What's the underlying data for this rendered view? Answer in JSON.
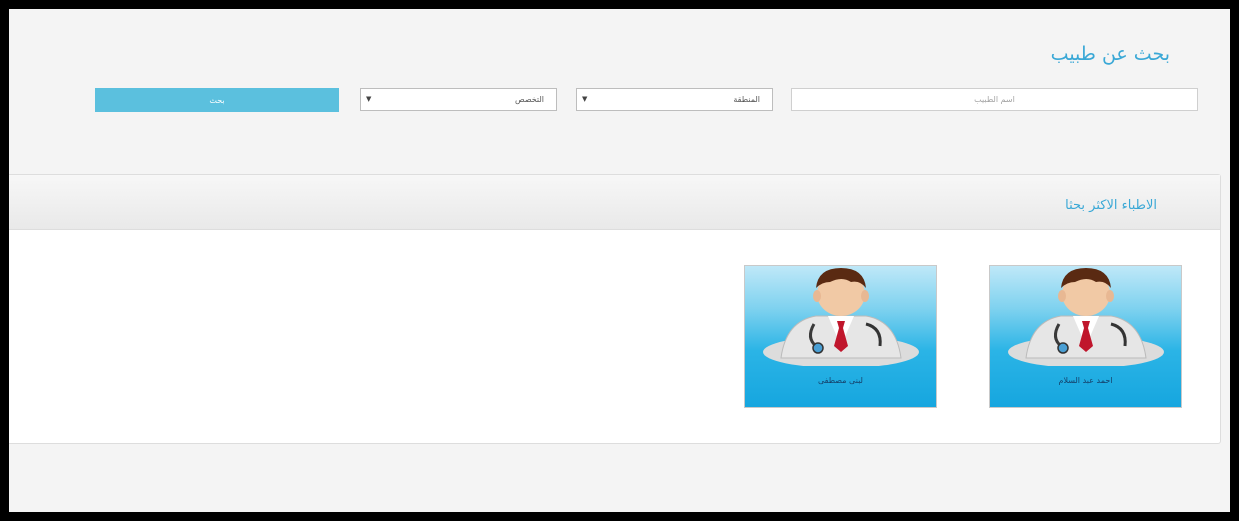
{
  "search": {
    "title": "بحث عن طبيب",
    "name_placeholder": "اسم الطبيب",
    "region_label": "المنطقة",
    "specialty_label": "التخصص",
    "button_label": "بحث"
  },
  "top_doctors": {
    "title": "الاطباء الاكثر بحثا",
    "doctors": [
      {
        "name": "احمد عبد السلام"
      },
      {
        "name": "لبنى مصطفى"
      }
    ]
  },
  "colors": {
    "accent": "#3aa8d6",
    "button": "#5bc0de",
    "card_bg": "#16a6df"
  },
  "icons": {
    "dropdown": "triangle-down-icon",
    "avatar": "doctor-avatar-icon"
  }
}
